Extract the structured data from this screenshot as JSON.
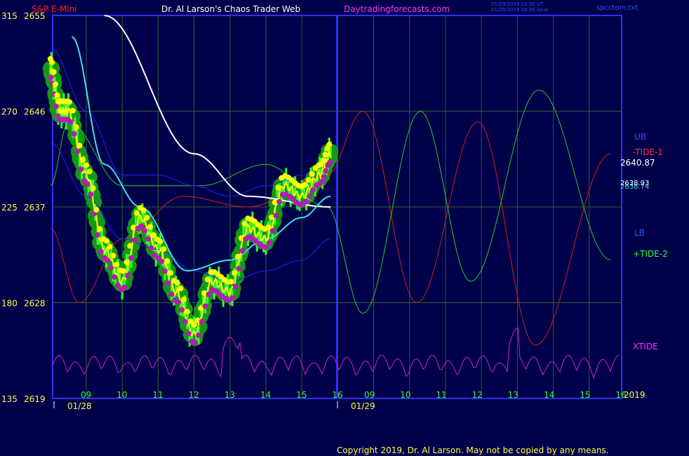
{
  "header": {
    "instrument": "S&P E-Mini",
    "author": "Dr. Al Larson's Chaos Trader Web",
    "site": "Daytradingforecasts.com",
    "stamp_utc": "01/29/2019 21:30 UT",
    "stamp_local": "01/29/2019 16:30 local",
    "file": "spcctom.txt"
  },
  "footer": {
    "copyright": "Copyright 2019, Dr. Al Larson. May not be copied by any means."
  },
  "colors": {
    "background": "#00004a",
    "grid": "#2f5f2f",
    "frame": "#3030ff",
    "white": "#ffffff",
    "yellow": "#ffff00",
    "cyan": "#40e0e0",
    "blue": "#2020ff",
    "green_line": "#20d020",
    "red_line": "#d02010",
    "magenta": "#d020d0",
    "green_blob": "#159915",
    "dot_green": "#30ff30",
    "dot_yellow": "#ffff00",
    "dot_magenta": "#b020b0"
  },
  "chart_data": {
    "type": "line",
    "y_left_labels": [
      {
        "left": "315",
        "right": "2655",
        "price": 2655
      },
      {
        "left": "270",
        "right": "2646",
        "price": 2646
      },
      {
        "left": "225",
        "right": "2637",
        "price": 2637
      },
      {
        "left": "180",
        "right": "2628",
        "price": 2628
      },
      {
        "left": "135",
        "right": "2619",
        "price": 2619
      }
    ],
    "ylim": [
      2619,
      2655
    ],
    "x_ticks_day1": [
      "09",
      "10",
      "11",
      "12",
      "13",
      "14",
      "15",
      "16"
    ],
    "x_ticks_day2": [
      "09",
      "10",
      "11",
      "12",
      "13",
      "14",
      "15",
      "16"
    ],
    "dates": [
      "01/28",
      "01/29"
    ],
    "year": "2019",
    "right_labels": {
      "ub": "UB",
      "tide1": "-TIDE-1",
      "price1": "2640.87",
      "price2": "2638.93",
      "price3": "2638.74",
      "lb": "LB",
      "tide2": "+TIDE-2",
      "xtide": "XTIDE"
    },
    "series": [
      {
        "name": "price",
        "x": [
          0,
          0.25,
          0.5,
          1,
          1.5,
          2,
          2.5,
          3,
          3.5,
          4,
          4.5,
          5,
          5.5,
          6,
          6.5,
          7,
          7.5,
          7.8
        ],
        "y": [
          2650,
          2646,
          2646,
          2640,
          2633,
          2630,
          2636,
          2633,
          2629,
          2625,
          2630,
          2629,
          2635,
          2634,
          2639,
          2638,
          2640,
          2642
        ]
      },
      {
        "name": "-TIDE-1",
        "x": [
          0,
          0.8,
          2,
          3.7,
          5.5,
          7.7,
          8.7,
          10.2,
          11.9,
          13.5,
          15.6
        ],
        "y": [
          2635,
          2628,
          2634,
          2638,
          2637,
          2640,
          2646,
          2628,
          2645,
          2624,
          2642
        ]
      },
      {
        "name": "+TIDE-2",
        "x": [
          0,
          0.5,
          2,
          4.2,
          6,
          7.7,
          8.7,
          10.3,
          11.7,
          13.6,
          15.6
        ],
        "y": [
          2639,
          2645,
          2639,
          2639,
          2641,
          2637,
          2627,
          2646,
          2630,
          2648,
          2632
        ]
      },
      {
        "name": "white",
        "x": [
          1.5,
          4,
          5.5,
          7.8
        ],
        "y": [
          2655,
          2642,
          2638,
          2637
        ]
      },
      {
        "name": "UB",
        "x": [
          0,
          1,
          2,
          3,
          4,
          5,
          6,
          7,
          7.8
        ],
        "y": [
          2652,
          2646,
          2640,
          2640,
          2639,
          2638,
          2639,
          2640,
          2641
        ]
      },
      {
        "name": "LB",
        "x": [
          0,
          1,
          2,
          3,
          4,
          5,
          6,
          7,
          7.8
        ],
        "y": [
          2643,
          2638,
          2634,
          2633,
          2631,
          2630,
          2631,
          2632,
          2634
        ]
      },
      {
        "name": "cyan",
        "x": [
          0.6,
          1.5,
          2.5,
          3.8,
          5,
          6,
          7,
          7.8
        ],
        "y": [
          2653,
          2641,
          2637,
          2631,
          2632,
          2634,
          2636,
          2638
        ]
      }
    ],
    "grid": true
  }
}
